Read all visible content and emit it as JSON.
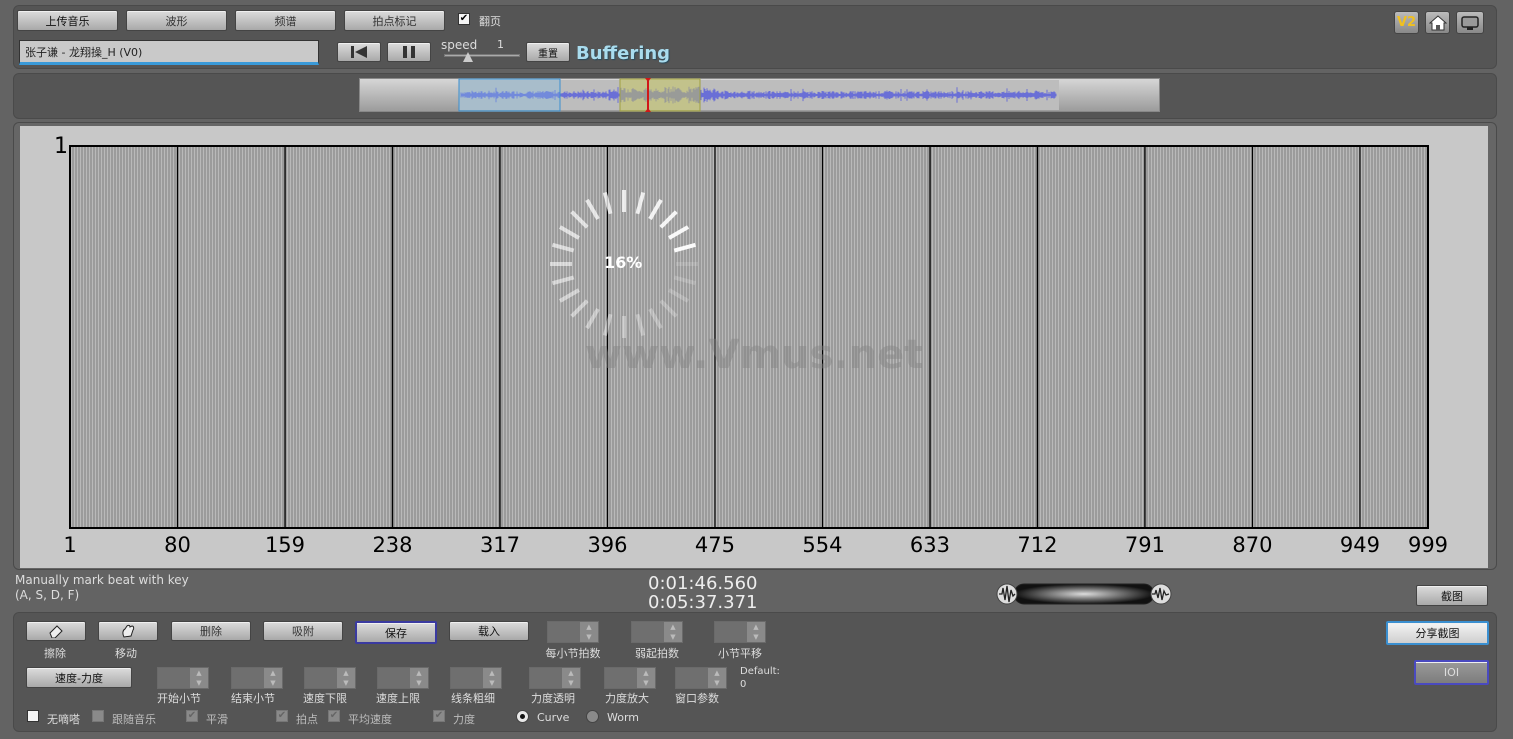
{
  "toolbar": {
    "upload": "上传音乐",
    "waveform": "波形",
    "spectrum": "频谱",
    "beat_mark": "拍点标记",
    "page_turn_label": "翻页",
    "page_turn_checked": true,
    "song_title": "张子谦 - 龙翔操_H (V0)",
    "speed_label": "speed",
    "speed_value": "1",
    "reset": "重置",
    "buffering": "Buffering",
    "version_badge": "V2"
  },
  "chart_data": {
    "type": "table",
    "ylabel_top": "1",
    "x_ticks": [
      "1",
      "80",
      "159",
      "238",
      "317",
      "396",
      "475",
      "554",
      "633",
      "712",
      "791",
      "870",
      "949",
      "999"
    ],
    "xlim": [
      1,
      999
    ],
    "ylim": [
      0,
      1
    ],
    "loading_percent": "16%",
    "watermark": "www.Vmus.net"
  },
  "status": {
    "hint_line1": "Manually mark beat with key",
    "hint_line2": "(A, S, D, F)",
    "time_current": "0:01:46.560",
    "time_total": "0:05:37.371",
    "screenshot": "截图"
  },
  "tools": {
    "erase": "擦除",
    "move": "移动",
    "delete": "删除",
    "snap": "吸附",
    "save": "保存",
    "load": "载入",
    "beats_per_bar": "每小节拍数",
    "pickup_beats": "弱起拍数",
    "bar_shift": "小节平移",
    "share_screenshot": "分享截图",
    "speed_force": "速度-力度",
    "start_bar": "开始小节",
    "end_bar": "结束小节",
    "speed_min": "速度下限",
    "speed_max": "速度上限",
    "line_width": "线条粗细",
    "force_transparency": "力度透明",
    "force_scale": "力度放大",
    "window_param": "窗口参数",
    "default_label": "Default:",
    "default_value": "0",
    "ioi": "IOI",
    "no_metronome": "无嘀嗒",
    "follow_music": "跟随音乐",
    "smooth": "平滑",
    "beat_point": "拍点",
    "avg_speed": "平均速度",
    "force": "力度",
    "curve": "Curve",
    "worm": "Worm"
  },
  "colors": {
    "background": "#636363",
    "chart_bg": "#c8c8c8",
    "waveform": "#6a6fd6",
    "playhead": "#d01818",
    "buffering": "#a9dcee",
    "badge": "#f0c020"
  }
}
